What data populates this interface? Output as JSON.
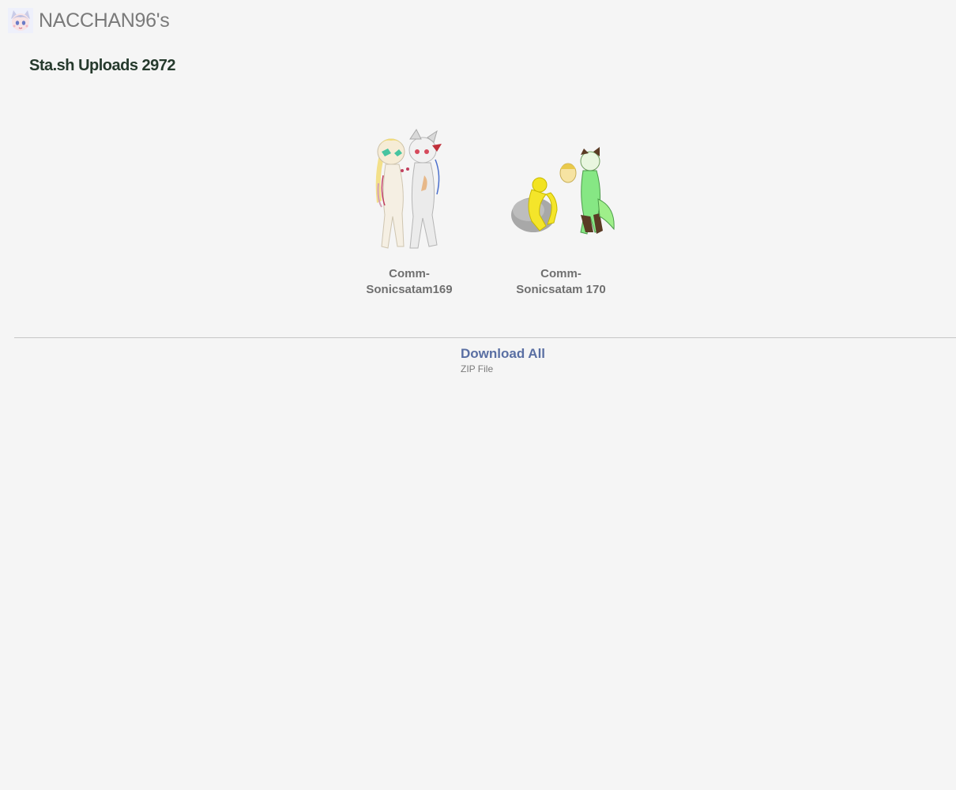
{
  "header": {
    "avatar_icon": "anime-avatar-icon",
    "username": "NACCHAN96's"
  },
  "page": {
    "title": "Sta.sh Uploads 2972"
  },
  "gallery": {
    "items": [
      {
        "label": "Comm-\nSonicsatam169",
        "thumbnail_icon": "character-art-thumbnail"
      },
      {
        "label": "Comm-\nSonicsatam 170",
        "thumbnail_icon": "character-art-thumbnail"
      }
    ]
  },
  "download": {
    "label": "Download All",
    "sublabel": "ZIP File"
  },
  "colors": {
    "background": "#f5f5f5",
    "title": "#263a2d",
    "link": "#5a6fa3",
    "muted": "#7a7a7a"
  }
}
